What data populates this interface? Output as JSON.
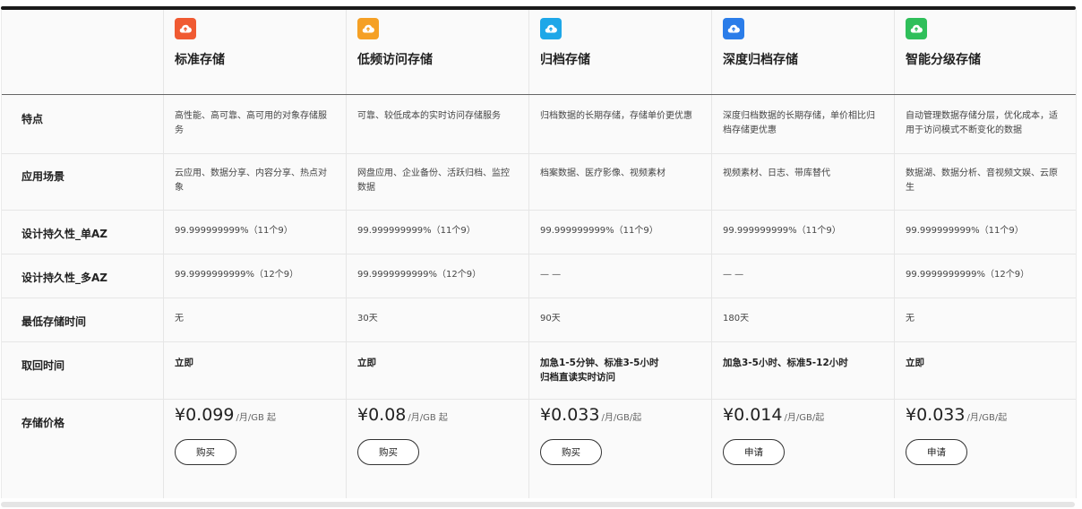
{
  "products": [
    {
      "name": "标准存储",
      "icon": "cloud-upload-icon",
      "color": "#f05a32",
      "feature": "高性能、高可靠、高可用的对象存储服务",
      "scenario": "云应用、数据分享、内容分享、热点对象",
      "durability_single": "99.999999999%（11个9）",
      "durability_multi": "99.9999999999%（12个9）",
      "min_time": "无",
      "retrieval": "立即",
      "price": "¥0.099",
      "price_unit": "/月/GB 起",
      "button": "购买"
    },
    {
      "name": "低频访问存储",
      "icon": "cloud-upload-icon",
      "color": "#f5a025",
      "feature": "可靠、较低成本的实时访问存储服务",
      "scenario": "网盘应用、企业备份、活跃归档、监控数据",
      "durability_single": "99.999999999%（11个9）",
      "durability_multi": "99.9999999999%（12个9）",
      "min_time": "30天",
      "retrieval": "立即",
      "price": "¥0.08",
      "price_unit": "/月/GB 起",
      "button": "购买"
    },
    {
      "name": "归档存储",
      "icon": "cloud-upload-icon",
      "color": "#1ea7e8",
      "feature": "归档数据的长期存储，存储单价更优惠",
      "scenario": "档案数据、医疗影像、视频素材",
      "durability_single": "99.999999999%（11个9）",
      "durability_multi": "— —",
      "min_time": "90天",
      "retrieval": "加急1-5分钟、标准3-5小时 归档直读实时访问",
      "price": "¥0.033",
      "price_unit": "/月/GB/起",
      "button": "购买"
    },
    {
      "name": "深度归档存储",
      "icon": "cloud-upload-icon",
      "color": "#2b7de9",
      "feature": "深度归档数据的长期存储，单价相比归档存储更优惠",
      "scenario": "视频素材、日志、带库替代",
      "durability_single": "99.999999999%（11个9）",
      "durability_multi": "— —",
      "min_time": "180天",
      "retrieval": "加急3-5小时、标准5-12小时",
      "price": "¥0.014",
      "price_unit": "/月/GB/起",
      "button": "申请"
    },
    {
      "name": "智能分级存储",
      "icon": "cloud-upload-icon",
      "color": "#2fbf5a",
      "feature": "自动管理数据存储分层，优化成本，适用于访问模式不断变化的数据",
      "scenario": "数据湖、数据分析、音视频文娱、云原生",
      "durability_single": "99.999999999%（11个9）",
      "durability_multi": "99.9999999999%（12个9）",
      "min_time": "无",
      "retrieval": "立即",
      "price": "¥0.033",
      "price_unit": "/月/GB/起",
      "button": "申请"
    }
  ],
  "rows": {
    "feature": "特点",
    "scenario": "应用场景",
    "durability_single": "设计持久性_单AZ",
    "durability_multi": "设计持久性_多AZ",
    "min_time": "最低存储时间",
    "retrieval": "取回时间",
    "price": "存储价格"
  }
}
